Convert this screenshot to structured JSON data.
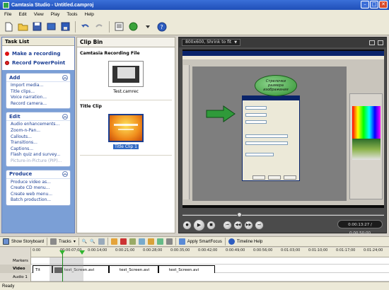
{
  "window": {
    "title": "Camtasia Studio - Untitled.camproj"
  },
  "menubar": {
    "items": [
      "File",
      "Edit",
      "View",
      "Play",
      "Tools",
      "Help"
    ]
  },
  "tasklist": {
    "title": "Task List",
    "quick": [
      "Make a recording",
      "Record PowerPoint"
    ],
    "groups": [
      {
        "title": "Add",
        "items": [
          "Import media...",
          "Title clips...",
          "Voice narration...",
          "Record camera..."
        ]
      },
      {
        "title": "Edit",
        "items": [
          "Audio enhancements...",
          "Zoom-n-Pan...",
          "Callouts...",
          "Transitions...",
          "Captions...",
          "Flash quiz and survey...",
          "Picture-in-Picture (PIP)..."
        ]
      },
      {
        "title": "Produce",
        "items": [
          "Produce video as...",
          "Create CD menu...",
          "Create web menu...",
          "Batch production..."
        ]
      }
    ]
  },
  "clipbin": {
    "title": "Clip Bin",
    "sections": [
      {
        "title": "Camtasia Recording File",
        "clip_label": "Test.camrec"
      },
      {
        "title": "Title Clip",
        "clip_label": "Title Clip 1"
      }
    ]
  },
  "preview": {
    "zoom_label": "800x600, Shrink to fit",
    "callout_text": "Стрелочки размера изображения",
    "time": "0:00:13:27 / 0:00:50:00"
  },
  "timeline_toolbar": {
    "storyboard_label": "Show Storyboard",
    "tracks_label": "Tracks",
    "smartfocus_label": "Apply SmartFocus",
    "help_label": "Timeline Help"
  },
  "timeline": {
    "track_labels": [
      "Markers",
      "Video",
      "Audio 1"
    ],
    "ticks": [
      "0:00",
      "00:00:07;00",
      "0:00:14;00",
      "0:00:21;00",
      "0:00:28;00",
      "0:00:35;00",
      "0:00:42;00",
      "0:00:49;00",
      "0:00:56;00",
      "0:01:03;00",
      "0:01:10;00",
      "0:01:17;00",
      "0:01:24;00",
      "0:01:31;00"
    ],
    "video_clips": [
      "Tit",
      "test_Screen.avi",
      "test_Screen.avi",
      "test_Screen.avi"
    ]
  },
  "status": {
    "text": "Ready"
  },
  "colors": {
    "accent": "#1c3f94",
    "panel": "#7b9fd6",
    "playhead": "#2fb52f"
  }
}
